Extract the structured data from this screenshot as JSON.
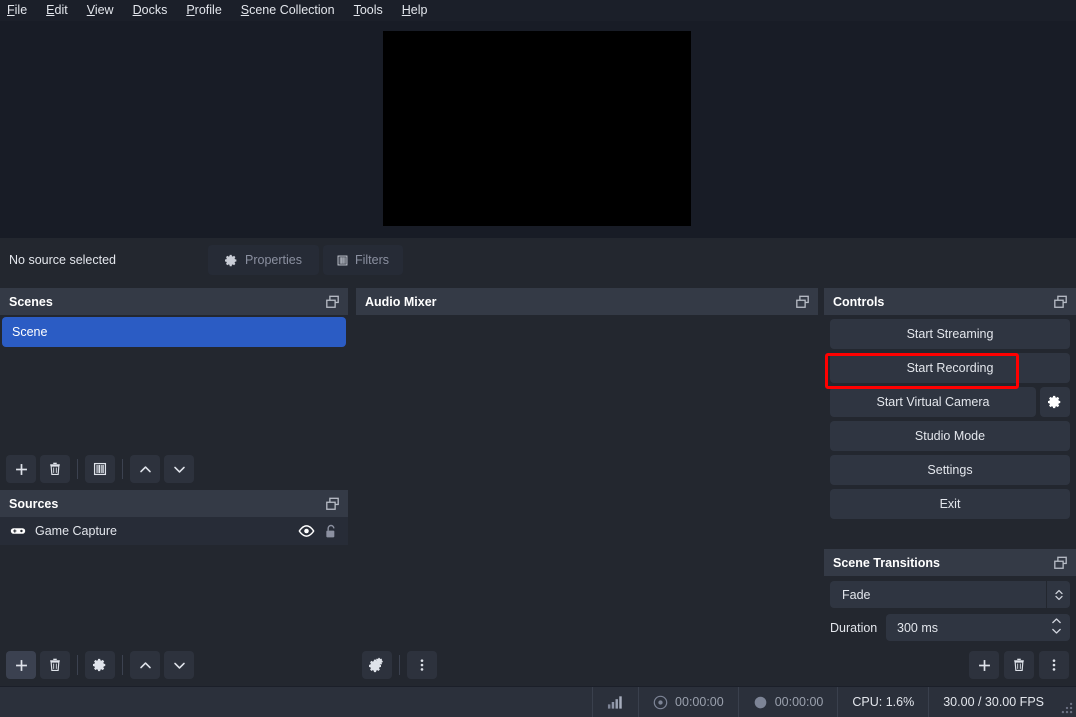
{
  "menu": {
    "items": [
      {
        "label": "File",
        "mnemonic": "F"
      },
      {
        "label": "Edit",
        "mnemonic": "E"
      },
      {
        "label": "View",
        "mnemonic": "V"
      },
      {
        "label": "Docks",
        "mnemonic": "D"
      },
      {
        "label": "Profile",
        "mnemonic": "P"
      },
      {
        "label": "Scene Collection",
        "mnemonic": "S"
      },
      {
        "label": "Tools",
        "mnemonic": "T"
      },
      {
        "label": "Help",
        "mnemonic": "H"
      }
    ]
  },
  "source_bar": {
    "status": "No source selected",
    "properties_label": "Properties",
    "filters_label": "Filters"
  },
  "scenes": {
    "title": "Scenes",
    "items": [
      {
        "label": "Scene",
        "selected": true
      }
    ],
    "toolbar": [
      "add-icon",
      "remove-icon",
      "filters-icon",
      "move-up-icon",
      "move-down-icon"
    ]
  },
  "sources": {
    "title": "Sources",
    "items": [
      {
        "label": "Game Capture",
        "icon": "gamepad-icon",
        "visible": true,
        "locked": false
      }
    ],
    "toolbar": [
      "add-icon",
      "remove-icon",
      "properties-gear-icon",
      "move-up-icon",
      "move-down-icon"
    ]
  },
  "mixer": {
    "title": "Audio Mixer",
    "toolbar": [
      "advanced-audio-gear-icon",
      "menu-dots-icon"
    ]
  },
  "controls": {
    "title": "Controls",
    "start_streaming": "Start Streaming",
    "start_recording": "Start Recording",
    "start_virtual_camera": "Start Virtual Camera",
    "studio_mode": "Studio Mode",
    "settings": "Settings",
    "exit": "Exit",
    "highlight_color": "#ff0000"
  },
  "transitions": {
    "title": "Scene Transitions",
    "selected_transition": "Fade",
    "duration_label": "Duration",
    "duration_value": "300 ms",
    "toolbar": [
      "add-icon",
      "remove-icon",
      "menu-dots-icon"
    ]
  },
  "statusbar": {
    "stream_time": "00:00:00",
    "record_time": "00:00:00",
    "cpu": "CPU: 1.6%",
    "fps": "30.00 / 30.00 FPS"
  }
}
